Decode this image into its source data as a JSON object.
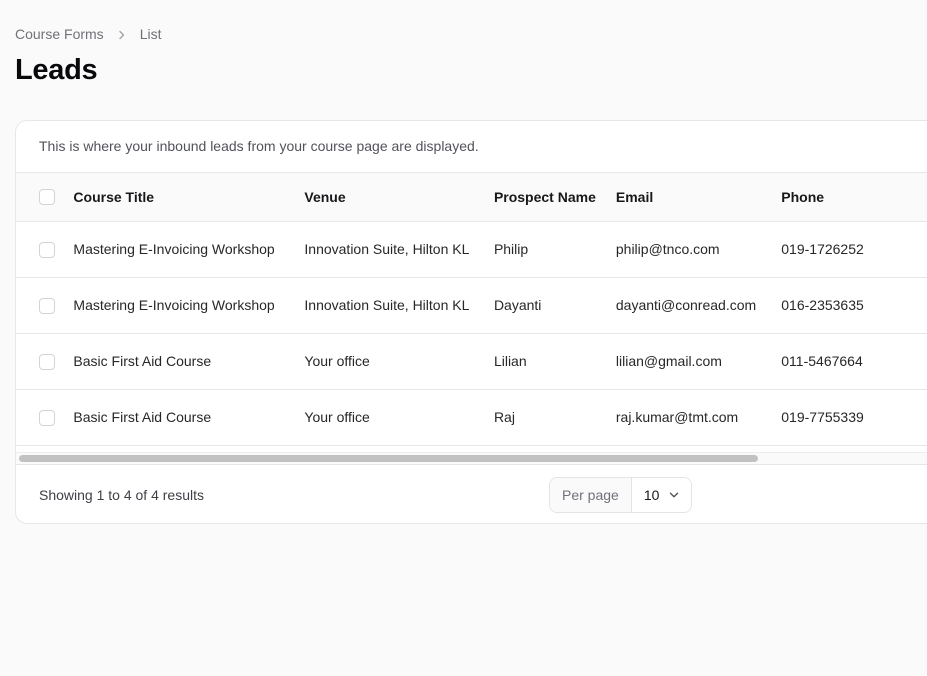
{
  "breadcrumb": {
    "items": [
      "Course Forms",
      "List"
    ],
    "separator_icon": "chevron-right-icon"
  },
  "page": {
    "title": "Leads"
  },
  "card": {
    "description": "This is where your inbound leads from your course page are displayed."
  },
  "table": {
    "columns": [
      "Course Title",
      "Venue",
      "Prospect Name",
      "Email",
      "Phone"
    ],
    "rows": [
      {
        "course_title": "Mastering E-Invoicing Workshop",
        "venue": "Innovation Suite, Hilton KL",
        "prospect_name": "Philip",
        "email": "philip@tnco.com",
        "phone": "019-1726252"
      },
      {
        "course_title": "Mastering E-Invoicing Workshop",
        "venue": "Innovation Suite, Hilton KL",
        "prospect_name": "Dayanti",
        "email": "dayanti@conread.com",
        "phone": "016-2353635"
      },
      {
        "course_title": "Basic First Aid Course",
        "venue": "Your office",
        "prospect_name": "Lilian",
        "email": "lilian@gmail.com",
        "phone": "011-5467664"
      },
      {
        "course_title": "Basic First Aid Course",
        "venue": "Your office",
        "prospect_name": "Raj",
        "email": "raj.kumar@tmt.com",
        "phone": "019-7755339"
      }
    ]
  },
  "pagination": {
    "summary": "Showing 1 to 4 of 4 results",
    "per_page_label": "Per page",
    "per_page_value": "10",
    "per_page_icon": "chevron-down-icon"
  },
  "colors": {
    "background": "#fafafa",
    "card": "#ffffff",
    "border": "#e7e7e9",
    "text_primary": "#18181b",
    "text_muted": "#71717a",
    "scrollbar_thumb": "#c1c1c1"
  }
}
